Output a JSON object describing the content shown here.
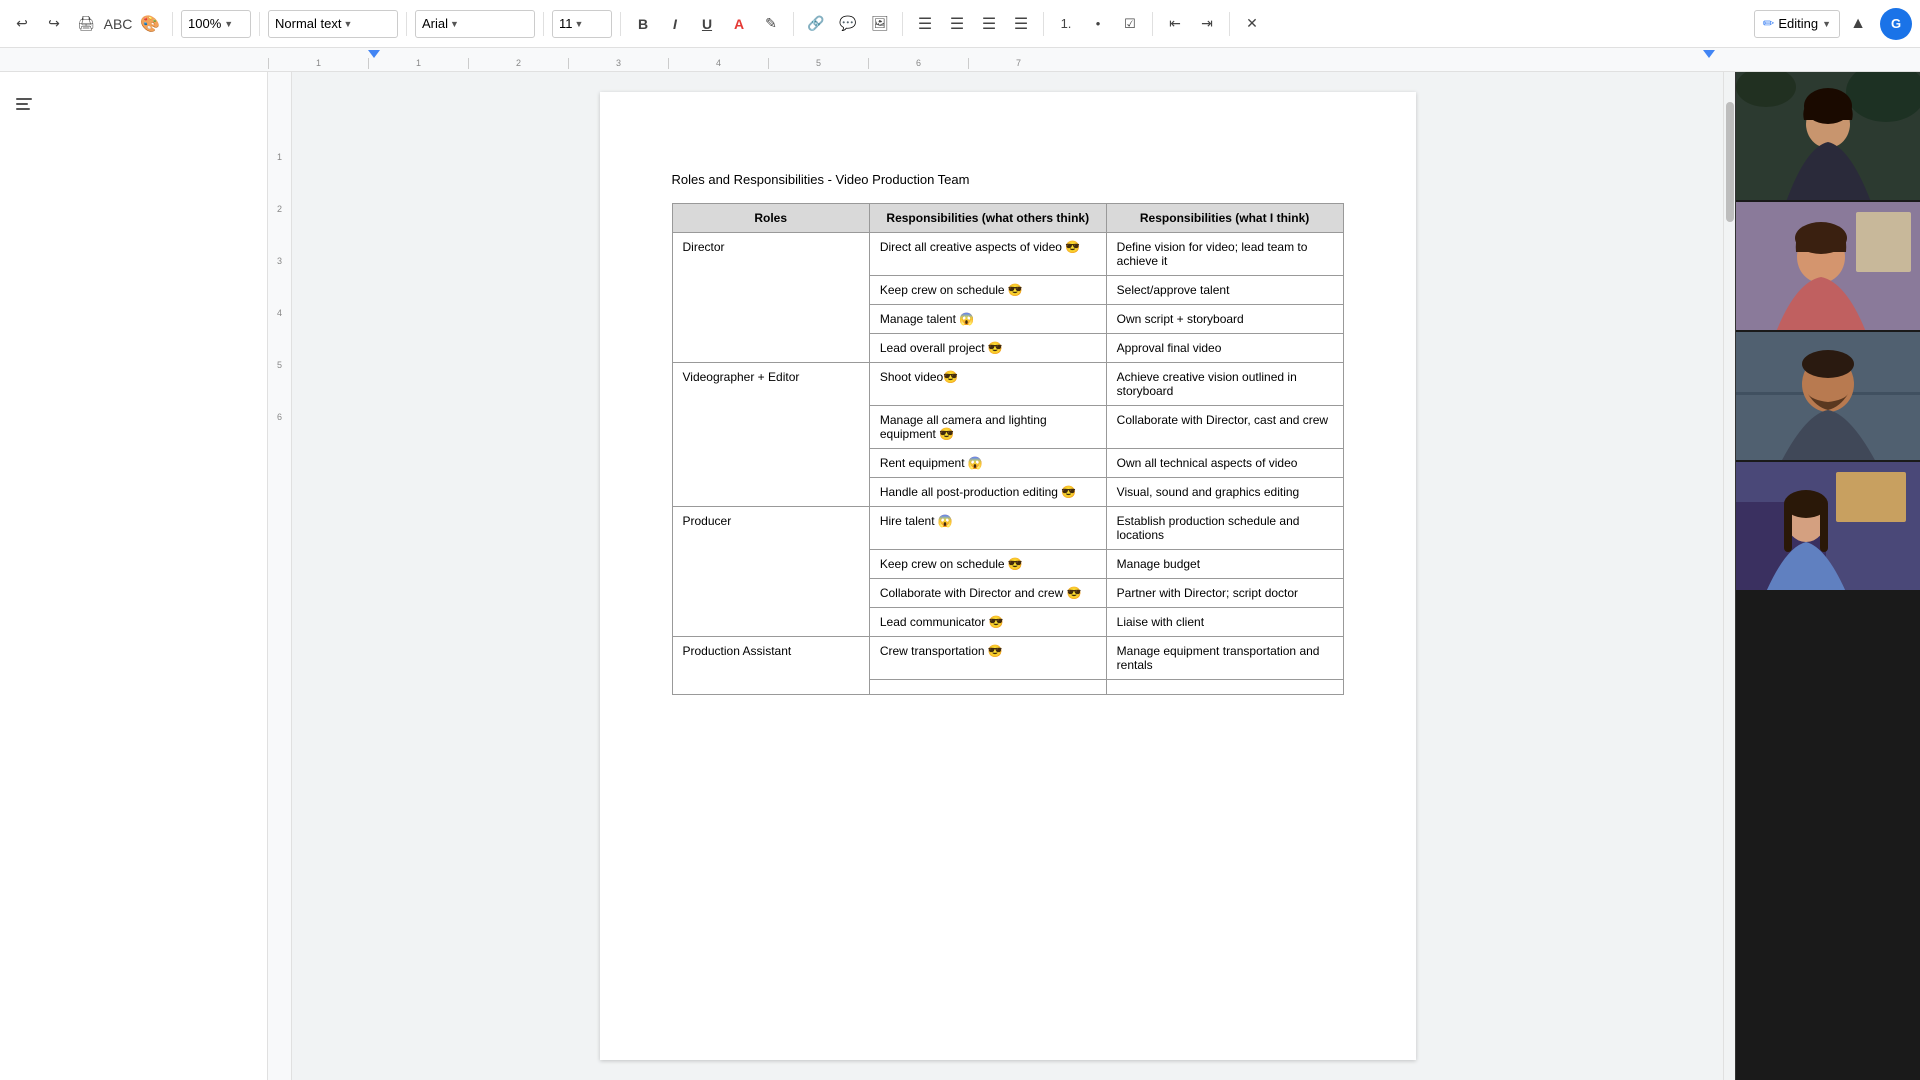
{
  "toolbar": {
    "zoom": "100%",
    "zoom_label": "100%",
    "style_label": "Normal text",
    "font_label": "Arial",
    "font_size": "11",
    "editing_label": "Editing",
    "undo_label": "Undo",
    "redo_label": "Redo",
    "print_label": "Print",
    "paint_format_label": "Paint format",
    "bold_label": "B",
    "italic_label": "I",
    "underline_label": "U",
    "text_color_label": "A",
    "highlight_label": "✎",
    "link_label": "🔗",
    "comment_label": "💬",
    "image_label": "🖼",
    "align_left": "≡",
    "align_center": "≡",
    "align_right": "≡",
    "justify": "≡",
    "numbered_list": "≡",
    "bulleted_list": "≡",
    "decrease_indent": "≡",
    "increase_indent": "≡",
    "clear_format": "✕"
  },
  "document": {
    "title": "Roles and Responsibilities - Video Production Team",
    "table": {
      "headers": [
        "Roles",
        "Responsibilities (what others think)",
        "Responsibilities (what I think)"
      ],
      "rows": [
        {
          "role": "Director",
          "others": [
            "Direct all creative aspects of video 😎",
            "Keep crew on schedule 😎",
            "Manage talent 😱",
            "Lead overall project 😎"
          ],
          "mine": [
            "Define vision for video; lead team to achieve it",
            "Select/approve talent",
            "Own script + storyboard",
            "Approval final video"
          ]
        },
        {
          "role": "Videographer + Editor",
          "others": [
            "Shoot video😎",
            "Manage all camera and lighting equipment 😎",
            "Rent equipment 😱",
            "Handle all post-production editing 😎"
          ],
          "mine": [
            "Achieve creative vision outlined in storyboard",
            "Collaborate with Director, cast and crew",
            "Own all technical aspects of video",
            "Visual, sound and graphics editing"
          ]
        },
        {
          "role": "Producer",
          "others": [
            "Hire talent 😱",
            "Keep crew on schedule 😎",
            "Collaborate with Director and crew 😎",
            "Lead communicator 😎"
          ],
          "mine": [
            "Establish production schedule and locations",
            "Manage budget",
            "Partner with Director; script doctor",
            "Liaise with client"
          ]
        },
        {
          "role": "Production Assistant",
          "others": [
            "Crew transportation 😎"
          ],
          "mine": [
            "Manage equipment transportation and rentals"
          ]
        }
      ]
    }
  },
  "ruler": {
    "marks": [
      "-1",
      "1",
      "2",
      "3",
      "4",
      "5",
      "6",
      "7"
    ]
  },
  "vertical_ruler": {
    "marks": [
      "1",
      "2",
      "3",
      "4",
      "5",
      "6"
    ]
  },
  "video_participants": [
    {
      "name": "",
      "bg": "tile-1"
    },
    {
      "name": "",
      "bg": "tile-2"
    },
    {
      "name": "",
      "bg": "tile-3"
    },
    {
      "name": "",
      "bg": "tile-4"
    }
  ]
}
